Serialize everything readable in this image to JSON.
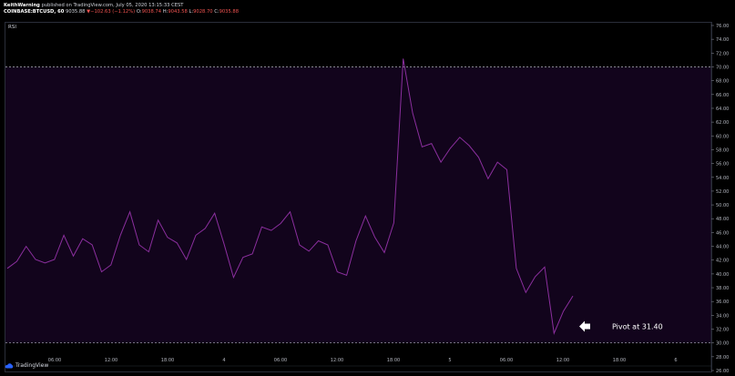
{
  "header": {
    "publisher_name": "KeithWarning",
    "publisher_rest": " published on TradingView.com, July 05, 2020 13:15:33 CEST",
    "symbol": "COINBASE:BTCUSD, 60",
    "price": "9035.88",
    "change_arrow": "▼",
    "change": "−102.63 (−1.12%)",
    "o_label": "O:",
    "o_value": "9038.74",
    "h_label": "H:",
    "h_value": "9043.58",
    "l_label": "L:",
    "l_value": "9028.70",
    "c_label": "C:",
    "c_value": "9035.88"
  },
  "indicator": {
    "label": "RSI"
  },
  "annotation": {
    "text": "Pivot at 31.40"
  },
  "footer": {
    "brand": "TradingView"
  },
  "colors": {
    "background": "#000000",
    "band": "#12041c",
    "rsi_line": "#8b2f9e",
    "guide": "#b2b5be",
    "down": "#ef5350"
  },
  "chart_data": {
    "type": "line",
    "title": "RSI",
    "ylim": [
      26,
      76
    ],
    "yticks": [
      "76.00",
      "74.00",
      "72.00",
      "70.00",
      "68.00",
      "66.00",
      "64.00",
      "62.00",
      "60.00",
      "58.00",
      "56.00",
      "54.00",
      "52.00",
      "50.00",
      "48.00",
      "46.00",
      "44.00",
      "42.00",
      "40.00",
      "38.00",
      "36.00",
      "34.00",
      "32.00",
      "30.00",
      "28.00",
      "26.00"
    ],
    "ytick_values": [
      76,
      74,
      72,
      70,
      68,
      66,
      64,
      62,
      60,
      58,
      56,
      54,
      52,
      50,
      48,
      46,
      44,
      42,
      40,
      38,
      36,
      34,
      32,
      30,
      28,
      26
    ],
    "xticks": [
      {
        "label": "06:00",
        "x": 6
      },
      {
        "label": "12:00",
        "x": 12
      },
      {
        "label": "18:00",
        "x": 18
      },
      {
        "label": "4",
        "x": 24
      },
      {
        "label": "06:00",
        "x": 30
      },
      {
        "label": "12:00",
        "x": 36
      },
      {
        "label": "18:00",
        "x": 42
      },
      {
        "label": "5",
        "x": 48
      },
      {
        "label": "06:00",
        "x": 54
      },
      {
        "label": "12:00",
        "x": 60
      },
      {
        "label": "18:00",
        "x": 66
      },
      {
        "label": "6",
        "x": 72
      }
    ],
    "xlim": [
      0,
      75
    ],
    "levels": {
      "upper": 70,
      "lower": 30
    },
    "series": [
      {
        "values": [
          40.8,
          41.8,
          44.0,
          42.1,
          41.6,
          42.1,
          45.6,
          42.6,
          45.1,
          44.2,
          40.3,
          41.3,
          45.6,
          49.0,
          44.2,
          43.2,
          47.8,
          45.3,
          44.5,
          42.1,
          45.6,
          46.6,
          48.8,
          44.3,
          39.5,
          42.4,
          42.9,
          46.8,
          46.3,
          47.3,
          49.0,
          44.2,
          43.3,
          44.8,
          44.2,
          40.3,
          39.8,
          44.8,
          48.4,
          45.3,
          43.1,
          47.4,
          71.2,
          63.3,
          58.4,
          58.9,
          56.2,
          58.2,
          59.8,
          58.6,
          56.9,
          53.8,
          56.2,
          55.1,
          40.8,
          37.3,
          39.6,
          41.0,
          31.4,
          34.6,
          36.8
        ]
      }
    ]
  }
}
